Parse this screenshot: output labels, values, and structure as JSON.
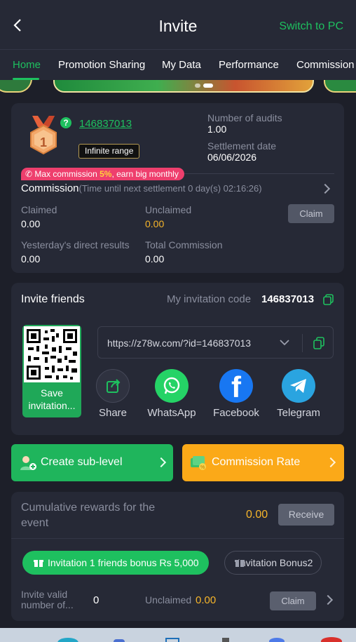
{
  "header": {
    "title": "Invite",
    "switch_label": "Switch to PC"
  },
  "tabs": [
    {
      "label": "Home",
      "active": true
    },
    {
      "label": "Promotion Sharing"
    },
    {
      "label": "My Data"
    },
    {
      "label": "Performance"
    },
    {
      "label": "Commission"
    }
  ],
  "account": {
    "level": "1",
    "user_id": "146837013",
    "range_badge": "Infinite range",
    "audits_label": "Number of audits",
    "audits_value": "1.00",
    "settlement_label": "Settlement date",
    "settlement_value": "06/06/2026"
  },
  "commission": {
    "promo_prefix": "Max commission ",
    "promo_highlight": "5%",
    "promo_suffix": ", earn big monthly",
    "title": "Commission",
    "timer_text": "(Time until next settlement  0 day(s) 02:16:26)",
    "claimed_label": "Claimed",
    "claimed_value": "0.00",
    "unclaimed_label": "Unclaimed",
    "unclaimed_value": "0.00",
    "claim_button": "Claim",
    "yesterday_label": "Yesterday's direct results",
    "yesterday_value": "0.00",
    "total_label": "Total Commission",
    "total_value": "0.00"
  },
  "invite": {
    "title": "Invite friends",
    "code_label": "My invitation code",
    "code_value": "146837013",
    "qr_label": "Save invitation...",
    "link": "https://z78w.com/?id=146837013",
    "share": [
      {
        "label": "Share",
        "icon": "share-icon",
        "color": "#2f3240"
      },
      {
        "label": "WhatsApp",
        "icon": "whatsapp-icon",
        "color": "#25d366"
      },
      {
        "label": "Facebook",
        "icon": "facebook-icon",
        "color": "#1877f2"
      },
      {
        "label": "Telegram",
        "icon": "telegram-icon",
        "color": "#2aa4e0"
      }
    ]
  },
  "actions": {
    "create_sub_level": "Create sub-level",
    "commission_rate": "Commission Rate"
  },
  "event": {
    "cumulative_label": "Cumulative rewards for the event",
    "cumulative_value": "0.00",
    "receive_button": "Receive",
    "bonus_pill_1": "Invitation 1 friends bonus Rs 5,000",
    "bonus_pill_2": "Invitation Bonus2",
    "valid_label": "Invite valid number of...",
    "valid_value": "0",
    "unclaimed_label": "Unclaimed",
    "unclaimed_value": "0.00",
    "claim_button": "Claim"
  },
  "colors": {
    "accent": "#1ec05f",
    "orange": "#fba918",
    "gold": "#f6b52a",
    "background": "#1d1f29",
    "card": "#262936"
  }
}
